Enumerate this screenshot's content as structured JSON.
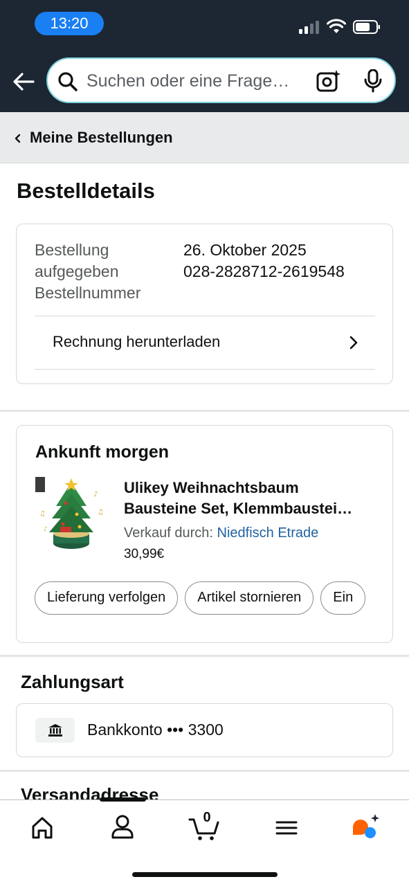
{
  "status_bar": {
    "time": "13:20"
  },
  "search": {
    "placeholder": "Suchen oder eine Frage…"
  },
  "breadcrumb": {
    "label": "Meine Bestellungen"
  },
  "page_title": "Bestelldetails",
  "order": {
    "label_date": "Bestellung aufgegeben",
    "label_number": "Bestellnummer",
    "date": "26. Oktober 2025",
    "number": "028-2828712-2619548",
    "invoice_label": "Rechnung herunterladen"
  },
  "delivery": {
    "title": "Ankunft morgen",
    "product_title_line1": "Ulikey Weihnachtsbaum",
    "product_title_line2": "Bausteine Set, Klemmbaustei…",
    "seller_prefix": "Verkauf durch:",
    "seller_name": "Niedfisch Etrade",
    "price": "30,99€",
    "actions": [
      "Lieferung verfolgen",
      "Artikel stornieren",
      "Ein"
    ]
  },
  "payment": {
    "title": "Zahlungsart",
    "method": "Bankkonto ••• 3300"
  },
  "shipping": {
    "title": "Versandadresse"
  },
  "bottom_nav": {
    "cart_count": "0"
  },
  "colors": {
    "header": "#1d2633",
    "link": "#2162a1",
    "time_pill": "#1a7ff2"
  },
  "icons": [
    "back-arrow-icon",
    "search-icon",
    "camera-lens-icon",
    "microphone-icon",
    "home-icon",
    "account-icon",
    "cart-icon",
    "menu-icon",
    "rufus-ai-icon",
    "bank-icon"
  ]
}
